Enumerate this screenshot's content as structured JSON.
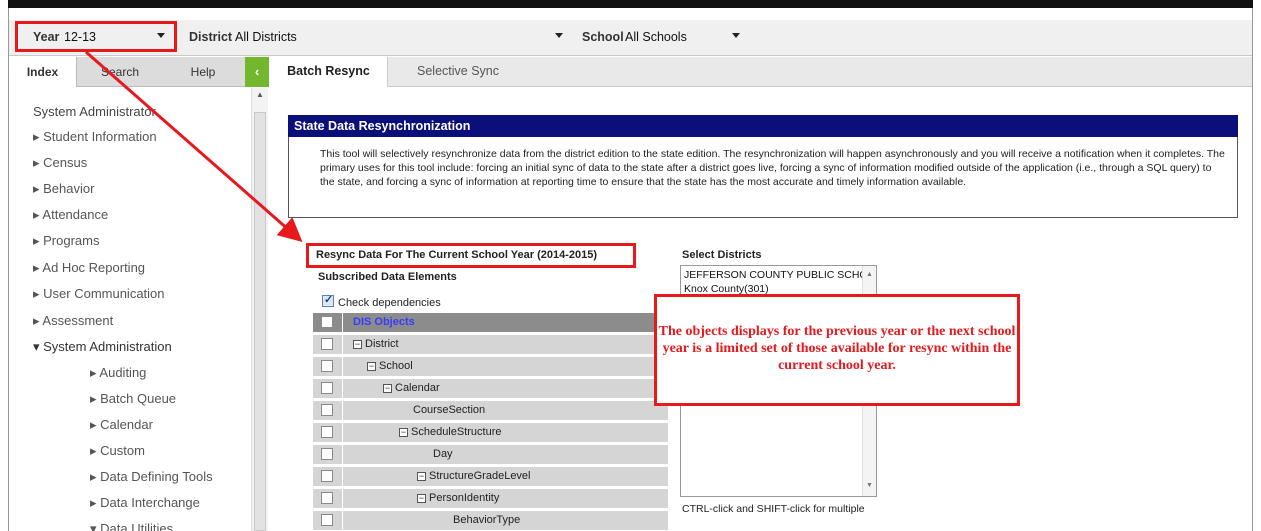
{
  "header": {
    "year_label": "Year",
    "year_value": "12-13",
    "district_label": "District",
    "district_value": "All Districts",
    "school_label": "School",
    "school_value": "All Schools"
  },
  "sidebar": {
    "tabs": [
      "Index",
      "Search",
      "Help"
    ],
    "collapse_icon": "‹",
    "root": "System Administrator",
    "items": [
      "▸ Student Information",
      "▸ Census",
      "▸ Behavior",
      "▸ Attendance",
      "▸ Programs",
      "▸ Ad Hoc Reporting",
      "▸ User Communication",
      "▸ Assessment",
      "▾ System Administration"
    ],
    "sub_items": [
      "▸ Auditing",
      "▸ Batch Queue",
      "▸ Calendar",
      "▸ Custom",
      "▸ Data Defining Tools",
      "▸ Data Interchange",
      "▾ Data Utilities"
    ]
  },
  "main": {
    "tabs": [
      "Batch Resync",
      "Selective Sync"
    ],
    "panel_title": "State Data Resynchronization",
    "panel_text": "This tool will selectively resynchronize data from the district edition to the state edition. The resynchronization will happen asynchronously and you will receive a notification when it completes. The primary uses for this tool include: forcing an initial sync of data to the state after a district goes live, forcing a sync of information modified outside of the application (i.e., through a SQL query) to the state, and forcing a sync of information at reporting time to ensure that the state has the most accurate and timely information available.",
    "resync_title": "Resync Data For The Current School Year (2014-2015)",
    "subscribed_title": "Subscribed Data Elements",
    "check_dependencies": "Check dependencies",
    "tree": [
      {
        "label": "DIS Objects",
        "indent": 0,
        "expander": false
      },
      {
        "label": "District",
        "indent": 0,
        "expander": true
      },
      {
        "label": "School",
        "indent": 1,
        "expander": true
      },
      {
        "label": "Calendar",
        "indent": 2,
        "expander": true
      },
      {
        "label": "CourseSection",
        "indent": 3,
        "expander": false
      },
      {
        "label": "ScheduleStructure",
        "indent": 3,
        "expander": true
      },
      {
        "label": "Day",
        "indent": 4,
        "expander": false
      },
      {
        "label": "StructureGradeLevel",
        "indent": 4,
        "expander": true
      },
      {
        "label": "PersonIdentity",
        "indent": 4,
        "expander": true
      },
      {
        "label": "BehaviorType",
        "indent": 5,
        "expander": false
      }
    ],
    "districts_title": "Select Districts",
    "districts": [
      "JEFFERSON COUNTY PUBLIC SCHOO",
      "Knox County(301)"
    ],
    "ctrl_hint": "CTRL-click and SHIFT-click for multiple"
  },
  "annotation": {
    "callout_text": "The objects displays for the previous year or the next school year is a limited set of those available for resync within the current school year.",
    "accent_color": "#e8191d"
  }
}
